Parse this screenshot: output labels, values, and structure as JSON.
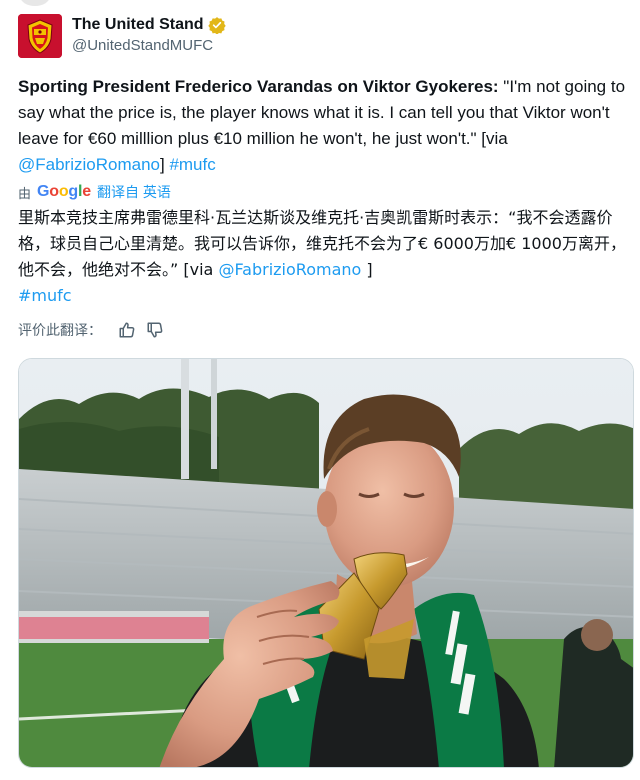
{
  "account": {
    "display_name": "The United Stand",
    "handle": "@UnitedStandMUFC",
    "verified": true,
    "avatar_icon": "shield-crest-icon"
  },
  "tweet": {
    "bold_lead": "Sporting President Frederico Varandas on Viktor Gyokeres:",
    "quote": " \"I'm not going to say what the price is, the player knows what it is. I can tell you that Viktor won't leave for €60 milllion plus €10 million he won't, he just won't.\" [via ",
    "mention": "@FabrizioRomano",
    "close": "] ",
    "hashtag": "#mufc"
  },
  "translation": {
    "by_label": "由",
    "provider": "Google",
    "action_label": "翻译自 英语",
    "text_main": "里斯本竞技主席弗雷德里科·瓦兰达斯谈及维克托·吉奥凯雷斯时表示：“我不会透露价格，球员自己心里清楚。我可以告诉你，维克托不会为了€ 6000万加€ 1000万离开，他不会，他绝对不会。” [via ",
    "mention": "@FabrizioRomano",
    "close": " ]",
    "hashtag": "#mufc",
    "rate_label": "评价此翻译："
  },
  "colors": {
    "link": "#1d9bf0",
    "muted": "#536471",
    "text": "#0f1419",
    "scarf_green": "#0b7a45"
  },
  "media": {
    "description_icon": "player-biting-medal-photo"
  }
}
